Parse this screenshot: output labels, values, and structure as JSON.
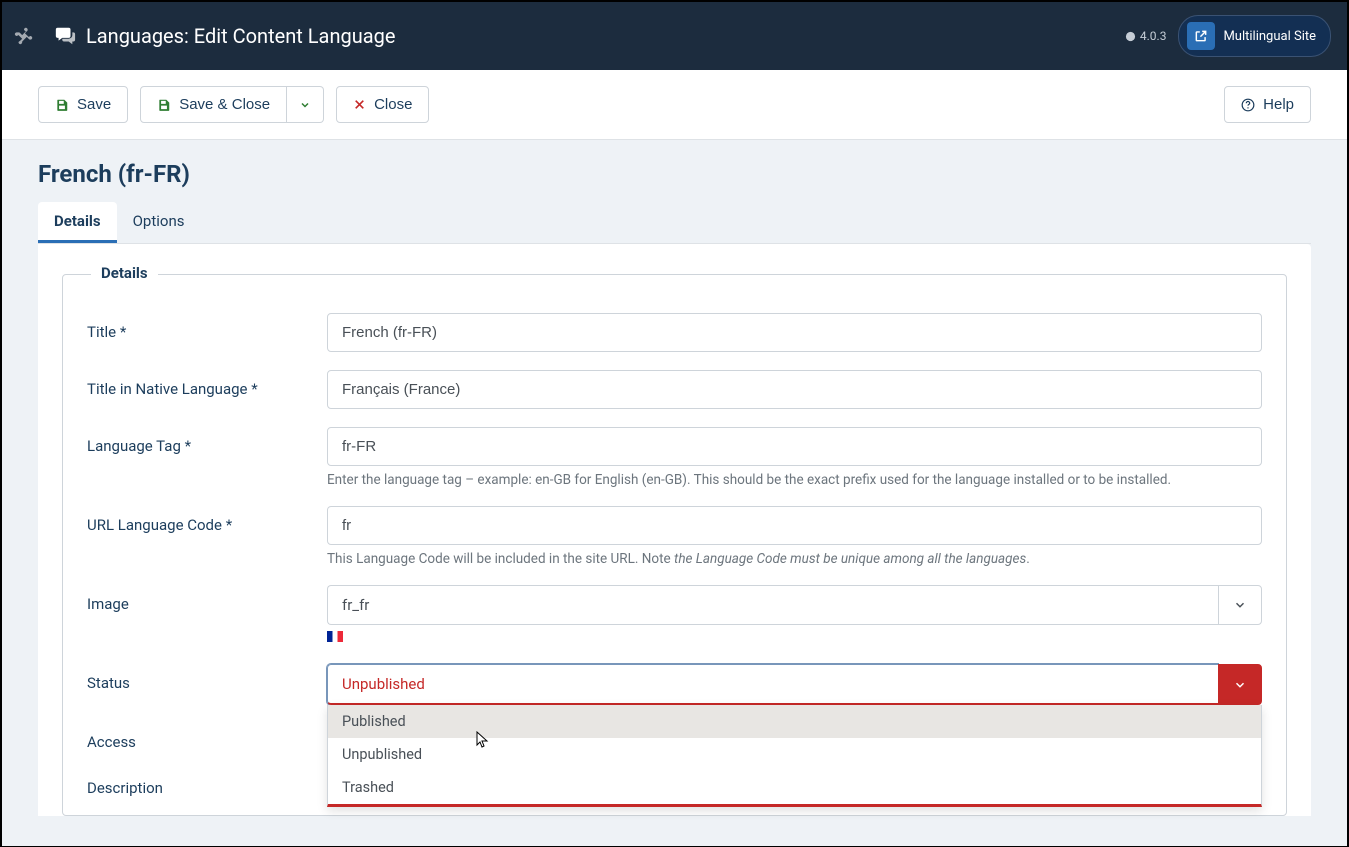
{
  "header": {
    "title": "Languages: Edit Content Language",
    "version": "4.0.3",
    "site_button": "Multilingual Site"
  },
  "toolbar": {
    "save": "Save",
    "save_close": "Save & Close",
    "close": "Close",
    "help": "Help"
  },
  "page": {
    "h1": "French (fr-FR)",
    "tabs": [
      "Details",
      "Options"
    ],
    "active_tab": 0
  },
  "fieldset_legend": "Details",
  "fields": {
    "title": {
      "label": "Title *",
      "value": "French (fr-FR)"
    },
    "native": {
      "label": "Title in Native Language *",
      "value": "Français (France)"
    },
    "tag": {
      "label": "Language Tag *",
      "value": "fr-FR",
      "help": "Enter the language tag – example: en-GB for English (en-GB). This should be the exact prefix used for the language installed or to be installed."
    },
    "urlcode": {
      "label": "URL Language Code *",
      "value": "fr",
      "help_pre": "This Language Code will be included in the site URL. Note ",
      "help_ital": "the Language Code must be unique among all the languages",
      "help_post": "."
    },
    "image": {
      "label": "Image",
      "value": "fr_fr"
    },
    "status": {
      "label": "Status",
      "value": "Unpublished",
      "options": [
        "Published",
        "Unpublished",
        "Trashed"
      ]
    },
    "access": {
      "label": "Access"
    },
    "description": {
      "label": "Description"
    }
  }
}
